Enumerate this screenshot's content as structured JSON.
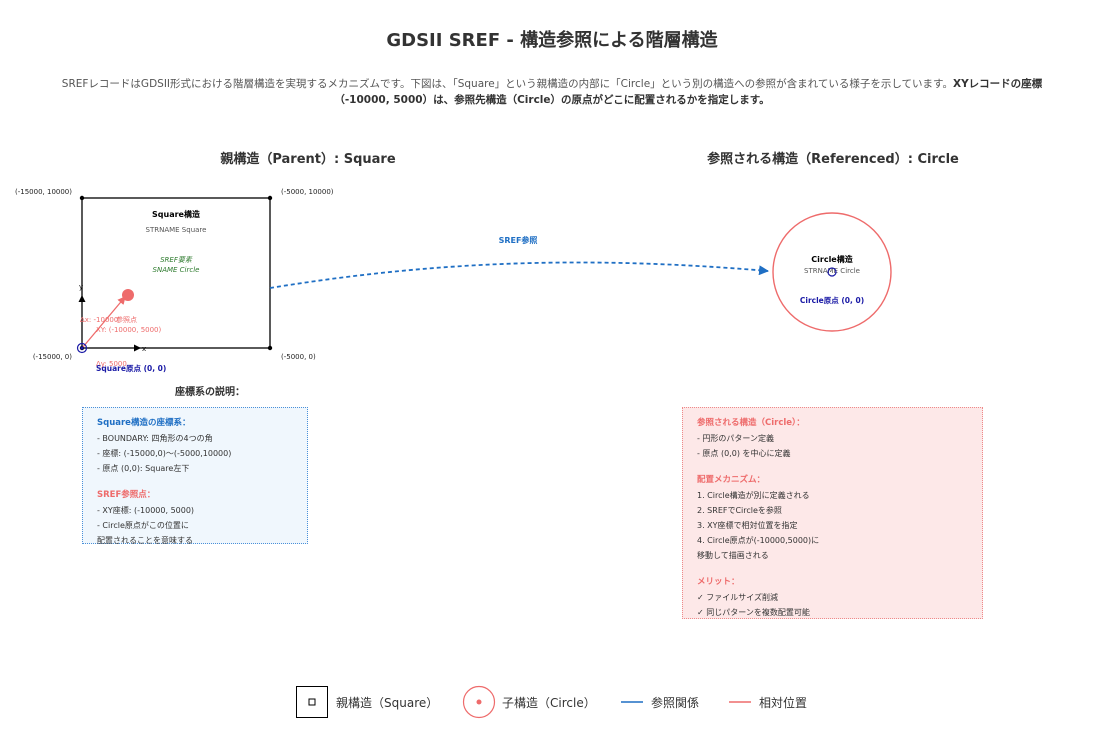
{
  "header": {
    "title": "GDSII SREF - 構造参照による階層構造",
    "intro_plain": "SREFレコードはGDSII形式における階層構造を実現するメカニズムです。下図は、「Square」という親構造の内部に「Circle」という別の構造への参照が含まれている様子を示しています。",
    "intro_bold": "XYレコードの座標（-10000, 5000）は、参照先構造（Circle）の原点がどこに配置されるかを指定します。"
  },
  "parent": {
    "section_title": "親構造（Parent）: Square",
    "struct_label": "Square構造",
    "strname": "STRNAME Square",
    "sref_label": "SREF要素",
    "sname": "SNAME Circle",
    "corner_tl": "(-15000, 10000)",
    "corner_tr": "(-5000, 10000)",
    "corner_bl": "(-15000, 0)",
    "corner_br": "(-5000, 0)",
    "ref_point_label": "参照点",
    "ref_point_xy": "XY: (-10000, 5000)",
    "dx_label": "Δx: -10000",
    "dy_label": "Δy: 5000",
    "axis_x": "x",
    "axis_y": "y",
    "origin_label": "Square原点 (0, 0)"
  },
  "arrow": {
    "label": "SREF参照"
  },
  "referenced": {
    "section_title": "参照される構造（Referenced）: Circle",
    "struct_label": "Circle構造",
    "strname": "STRNAME Circle",
    "origin_label": "Circle原点 (0, 0)"
  },
  "coord_title": "座標系の説明：",
  "panel_left": {
    "heading1": "Square構造の座標系：",
    "lines1": [
      "- BOUNDARY: 四角形の4つの角",
      "- 座標: (-15000,0)〜(-5000,10000)",
      "- 原点 (0,0): Square左下"
    ],
    "heading2": "SREF参照点：",
    "lines2": [
      "- XY座標: (-10000, 5000)",
      "- Circle原点がこの位置に",
      "配置されることを意味する"
    ]
  },
  "panel_right": {
    "heading1": "参照される構造（Circle）：",
    "lines1": [
      "- 円形のパターン定義",
      "- 原点 (0,0) を中心に定義"
    ],
    "heading2": "配置メカニズム：",
    "lines2": [
      "1. Circle構造が別に定義される",
      "2. SREFでCircleを参照",
      "3. XY座標で相対位置を指定",
      "4. Circle原点が(-10000,5000)に",
      "移動して描画される"
    ],
    "heading3": "メリット：",
    "lines3": [
      "✓ ファイルサイズ削減",
      "✓ 同じパターンを複数配置可能"
    ]
  },
  "legend": {
    "parent": "親構造（Square）",
    "child": "子構造（Circle）",
    "reference": "参照関係",
    "relative": "相対位置"
  },
  "colors": {
    "blue": "#1f6fc4",
    "red": "#ee6b6b",
    "green": "#2d7a2d",
    "navy": "#1a1aa6"
  }
}
